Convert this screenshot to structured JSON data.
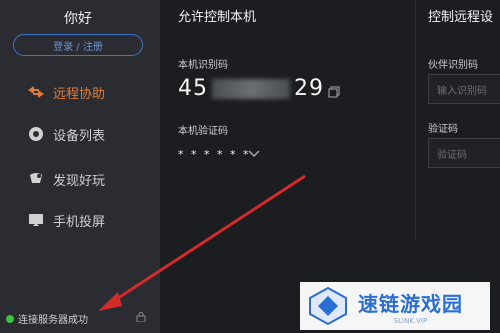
{
  "sidebar": {
    "greeting": "你好",
    "login_label": "登录 / 注册",
    "items": [
      {
        "label": "远程协助",
        "icon": "remote-assist-icon",
        "active": true
      },
      {
        "label": "设备列表",
        "icon": "device-list-icon",
        "active": false
      },
      {
        "label": "发现好玩",
        "icon": "discover-icon",
        "active": false
      },
      {
        "label": "手机投屏",
        "icon": "screen-mirror-icon",
        "active": false
      }
    ],
    "status_text": "连接服务器成功",
    "status_color": "#3fbf3f"
  },
  "allow": {
    "title": "允许控制本机",
    "id_label": "本机识别码",
    "id_prefix": "45",
    "id_suffix": "29",
    "code_label": "本机验证码",
    "code_value": "* * * * * *"
  },
  "control": {
    "title": "控制远程设",
    "partner_label": "伙伴识别码",
    "partner_placeholder": "输入识别码",
    "code_label": "验证码",
    "code_placeholder": "验证码"
  },
  "watermark": {
    "main": "速链游戏园",
    "sub": "SLINK.VIP"
  },
  "colors": {
    "accent_active": "#e07b3a",
    "login_border": "#3f74c8",
    "annotation_arrow": "#d32a2a"
  }
}
